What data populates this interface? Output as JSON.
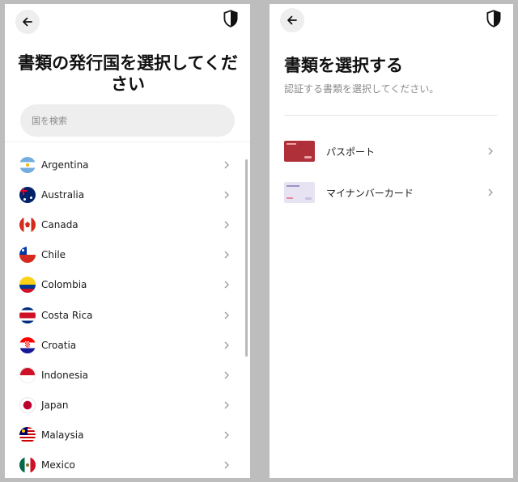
{
  "left_screen": {
    "title": "書類の発行国を選択してください",
    "search_placeholder": "国を検索",
    "countries": [
      {
        "name": "Argentina",
        "flag": "argentina-flag-icon"
      },
      {
        "name": "Australia",
        "flag": "australia-flag-icon"
      },
      {
        "name": "Canada",
        "flag": "canada-flag-icon"
      },
      {
        "name": "Chile",
        "flag": "chile-flag-icon"
      },
      {
        "name": "Colombia",
        "flag": "colombia-flag-icon"
      },
      {
        "name": "Costa Rica",
        "flag": "costa-rica-flag-icon"
      },
      {
        "name": "Croatia",
        "flag": "croatia-flag-icon"
      },
      {
        "name": "Indonesia",
        "flag": "indonesia-flag-icon"
      },
      {
        "name": "Japan",
        "flag": "japan-flag-icon"
      },
      {
        "name": "Malaysia",
        "flag": "malaysia-flag-icon"
      },
      {
        "name": "Mexico",
        "flag": "mexico-flag-icon"
      }
    ]
  },
  "right_screen": {
    "title": "書類を選択する",
    "subtitle": "認証する書類を選択してください。",
    "documents": [
      {
        "label": "パスポート",
        "thumb": "passport-thumbnail",
        "color": "#b0303a"
      },
      {
        "label": "マイナンバーカード",
        "thumb": "my-number-card-thumbnail",
        "color": "#e7e3f2"
      }
    ]
  },
  "icons": {
    "back": "back-arrow-icon",
    "shield": "shield-icon",
    "chevron": "chevron-right-icon"
  },
  "colors": {
    "background": "#bdbdbd",
    "search_bg": "#eeeeee",
    "subtitle": "#8c8c8c"
  }
}
